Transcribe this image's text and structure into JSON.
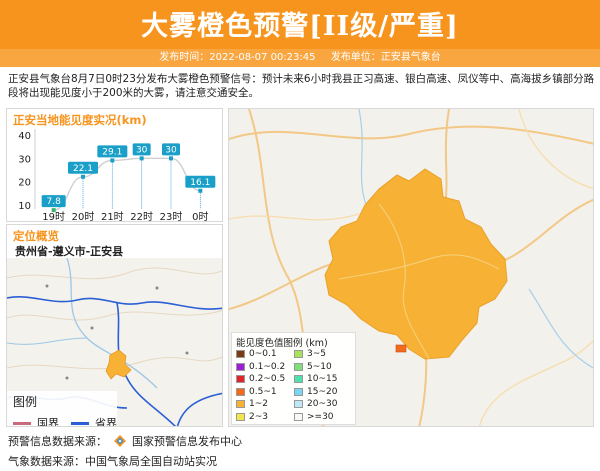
{
  "header": {
    "title": "大雾橙色预警[II级/严重]",
    "publish_time_label": "发布时间：2022-08-07 00:23:45",
    "publish_unit_label": "发布单位：正安县气象台"
  },
  "description": "正安县气象台8月7日0时23分发布大雾橙色预警信号：预计未来6小时我县正习高速、银白高速、凤仪等中、高海拔乡镇部分路段将出现能见度小于200米的大雾，请注意交通安全。",
  "visibility_panel": {
    "title": "正安当地能见度实况(km)"
  },
  "chart_data": {
    "type": "line",
    "title": "正安当地能见度实况(km)",
    "categories": [
      "19时",
      "20时",
      "21时",
      "22时",
      "23时",
      "0时"
    ],
    "values": [
      7.8,
      22.1,
      29.1,
      30,
      30,
      16.1
    ],
    "value_labels": [
      "7.8",
      "22.1",
      "29.1",
      "30",
      "30",
      "16.1"
    ],
    "yticks": [
      10,
      20,
      30,
      40
    ],
    "ylim": [
      10,
      40
    ],
    "grid": false,
    "colors": {
      "bar_top": "#3cb371",
      "label_bg": "#1a9fc9",
      "trend": "#cfcfcf",
      "stem": "#2b8fd6"
    }
  },
  "location_panel": {
    "title": "定位概览",
    "path": "贵州省-遵义市-正安县",
    "legend": {
      "title": "图例",
      "items": [
        {
          "label": "国界",
          "color": "#c86a7b"
        },
        {
          "label": "省界",
          "color": "#2b5fd6"
        }
      ]
    }
  },
  "visibility_legend": {
    "title": "能见度色值图例 (km)",
    "items": [
      {
        "label": "0~0.1",
        "color": "#7a3b16"
      },
      {
        "label": "3~5",
        "color": "#a6e35a"
      },
      {
        "label": "0.1~0.2",
        "color": "#9b1fd6"
      },
      {
        "label": "5~10",
        "color": "#7fe07a"
      },
      {
        "label": "0.2~0.5",
        "color": "#e0262b"
      },
      {
        "label": "10~15",
        "color": "#4fe0b0"
      },
      {
        "label": "0.5~1",
        "color": "#f26b1d"
      },
      {
        "label": "15~20",
        "color": "#7ad6f0"
      },
      {
        "label": "1~2",
        "color": "#f7b236"
      },
      {
        "label": "20~30",
        "color": "#bfe7f7"
      },
      {
        "label": "2~3",
        "color": "#f2e64a"
      },
      {
        "label": ">=30",
        "color": "#f8f8f8"
      }
    ]
  },
  "footer": {
    "warning_source": "预警信息数据来源：",
    "warning_source_name": "国家预警信息发布中心",
    "weather_source": "气象数据来源：中国气象局全国自动站实况"
  },
  "colors": {
    "brand": "#f7941d",
    "area_fill": "#f7b236"
  }
}
